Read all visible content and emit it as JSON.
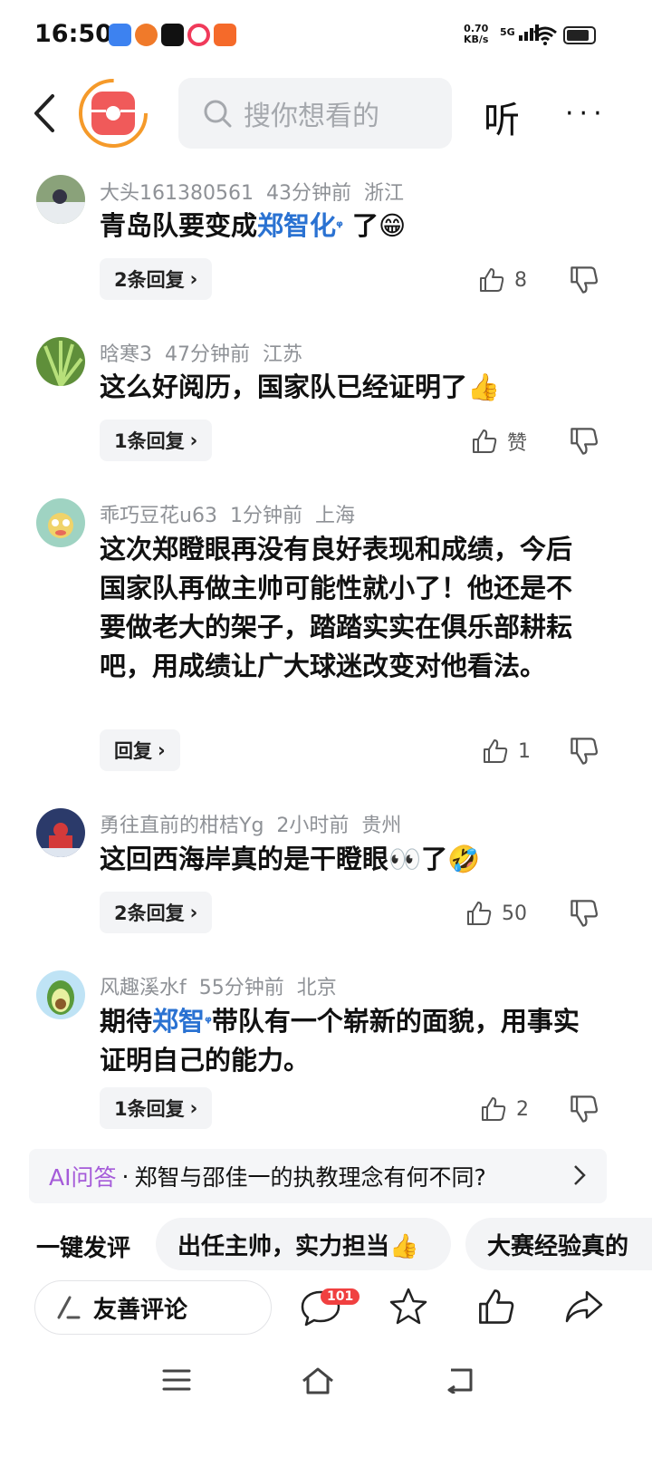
{
  "status_bar": {
    "time": "16:50",
    "net_speed_value": "0.70",
    "net_speed_unit": "KB/s",
    "network": "5G"
  },
  "header": {
    "search_placeholder": "搜你想看的",
    "listen_label": "听",
    "more_label": "···"
  },
  "comments": [
    {
      "user": "大头161380561",
      "time": "43分钟前",
      "location": "浙江",
      "text_before": "青岛队要变成",
      "highlight": "郑智化",
      "text_after": " 了",
      "emoji": "😁",
      "reply_label": "2条回复",
      "likes": "8"
    },
    {
      "user": "晗寒3",
      "time": "47分钟前",
      "location": "江苏",
      "text": "这么好阅历，国家队已经证明了",
      "emoji": "👍",
      "reply_label": "1条回复",
      "likes": "赞"
    },
    {
      "user": "乖巧豆花u63",
      "time": "1分钟前",
      "location": "上海",
      "text": "这次郑瞪眼再没有良好表现和成绩，今后国家队再做主帅可能性就小了！他还是不要做老大的架子，踏踏实实在俱乐部耕耘吧，用成绩让广大球迷改变对他看法。",
      "reply_label": "回复",
      "likes": "1"
    },
    {
      "user": "勇往直前的柑桔Yg",
      "time": "2小时前",
      "location": "贵州",
      "text": "这回西海岸真的是干瞪眼",
      "emoji_eyes": "👀",
      "text_after": "了",
      "emoji": "🤣",
      "reply_label": "2条回复",
      "likes": "50"
    },
    {
      "user": "风趣溪水f",
      "time": "55分钟前",
      "location": "北京",
      "text_before": "期待",
      "highlight": "郑智",
      "text_after": "带队有一个崭新的面貌，用事实证明自己的能力。",
      "reply_label": "1条回复",
      "likes": "2"
    }
  ],
  "ai_bar": {
    "tag": "AI问答",
    "dot": "·",
    "question": "郑智与邵佳一的执教理念有何不同?"
  },
  "quick_comment": {
    "label": "一键发评",
    "chips": [
      "出任主帅，实力担当👍",
      "大赛经验真的"
    ]
  },
  "bottom_bar": {
    "write_label": "友善评论",
    "comment_count": "101"
  },
  "colors": {
    "accent_blue": "#2a72d2",
    "ai_purple": "#a55bd9",
    "badge_red": "#f04040",
    "logo_red": "#f05a5a"
  }
}
